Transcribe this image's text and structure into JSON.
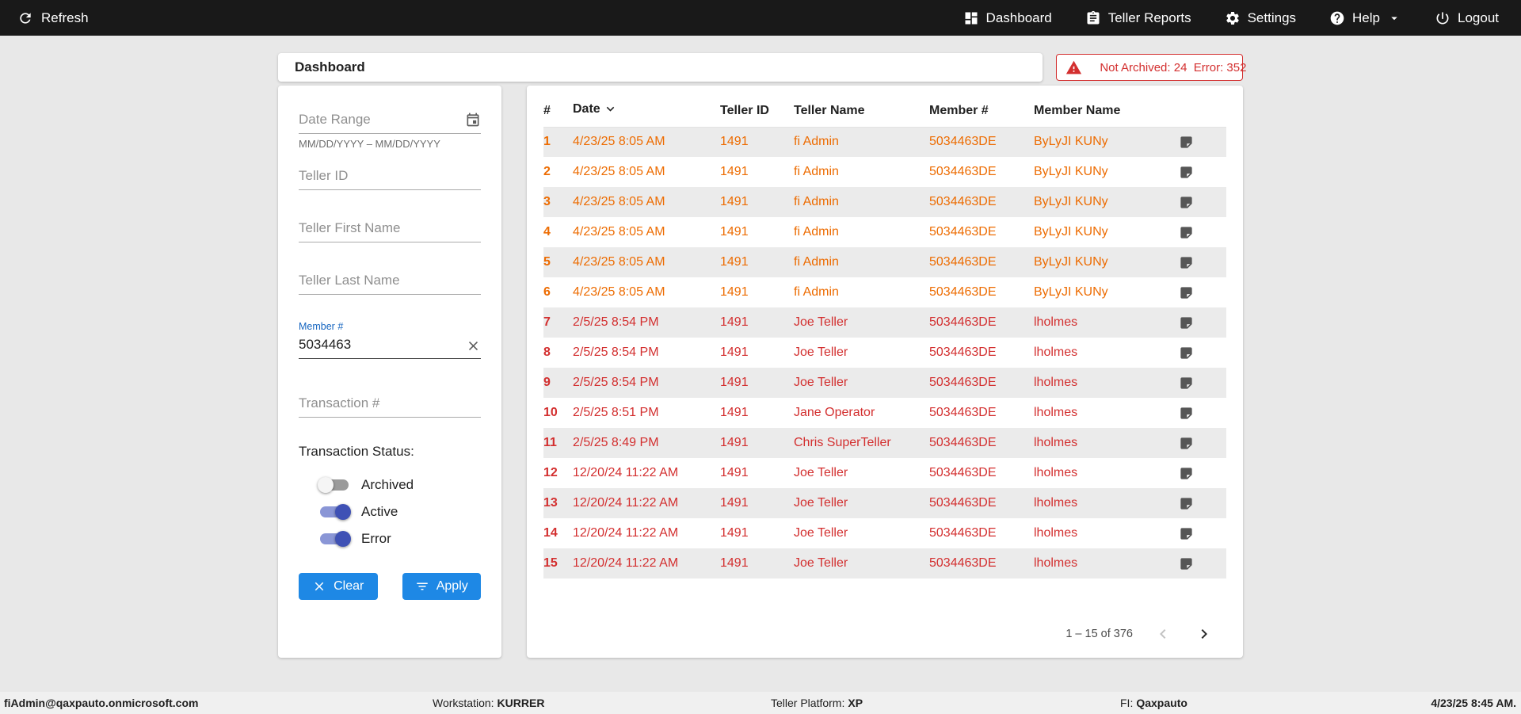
{
  "navbar": {
    "refresh_label": "Refresh",
    "dashboard_label": "Dashboard",
    "teller_reports_label": "Teller Reports",
    "settings_label": "Settings",
    "help_label": "Help",
    "logout_label": "Logout"
  },
  "header": {
    "title": "Dashboard",
    "alert_text": "Not Archived: 24  Error: 352"
  },
  "filters": {
    "date_range_placeholder": "Date Range",
    "date_range_helper": "MM/DD/YYYY – MM/DD/YYYY",
    "teller_id_placeholder": "Teller ID",
    "teller_first_name_placeholder": "Teller First Name",
    "teller_last_name_placeholder": "Teller Last Name",
    "member_label": "Member #",
    "member_value": "5034463",
    "transaction_placeholder": "Transaction #",
    "status_label": "Transaction Status:",
    "toggles": [
      {
        "label": "Archived",
        "on": false
      },
      {
        "label": "Active",
        "on": true
      },
      {
        "label": "Error",
        "on": true
      }
    ],
    "clear_label": "Clear",
    "apply_label": "Apply"
  },
  "table": {
    "columns": [
      "#",
      "Date",
      "Teller ID",
      "Teller Name",
      "Member #",
      "Member Name"
    ],
    "rows": [
      {
        "num": "1",
        "date": "4/23/25 8:05 AM",
        "teller_id": "1491",
        "teller_name": "fi Admin",
        "member": "5034463DE",
        "member_name": "ByLyJI KUNy",
        "status": "warning"
      },
      {
        "num": "2",
        "date": "4/23/25 8:05 AM",
        "teller_id": "1491",
        "teller_name": "fi Admin",
        "member": "5034463DE",
        "member_name": "ByLyJI KUNy",
        "status": "warning"
      },
      {
        "num": "3",
        "date": "4/23/25 8:05 AM",
        "teller_id": "1491",
        "teller_name": "fi Admin",
        "member": "5034463DE",
        "member_name": "ByLyJI KUNy",
        "status": "warning"
      },
      {
        "num": "4",
        "date": "4/23/25 8:05 AM",
        "teller_id": "1491",
        "teller_name": "fi Admin",
        "member": "5034463DE",
        "member_name": "ByLyJI KUNy",
        "status": "warning"
      },
      {
        "num": "5",
        "date": "4/23/25 8:05 AM",
        "teller_id": "1491",
        "teller_name": "fi Admin",
        "member": "5034463DE",
        "member_name": "ByLyJI KUNy",
        "status": "warning"
      },
      {
        "num": "6",
        "date": "4/23/25 8:05 AM",
        "teller_id": "1491",
        "teller_name": "fi Admin",
        "member": "5034463DE",
        "member_name": "ByLyJI KUNy",
        "status": "warning"
      },
      {
        "num": "7",
        "date": "2/5/25 8:54 PM",
        "teller_id": "1491",
        "teller_name": "Joe Teller",
        "member": "5034463DE",
        "member_name": "lholmes",
        "status": "error"
      },
      {
        "num": "8",
        "date": "2/5/25 8:54 PM",
        "teller_id": "1491",
        "teller_name": "Joe Teller",
        "member": "5034463DE",
        "member_name": "lholmes",
        "status": "error"
      },
      {
        "num": "9",
        "date": "2/5/25 8:54 PM",
        "teller_id": "1491",
        "teller_name": "Joe Teller",
        "member": "5034463DE",
        "member_name": "lholmes",
        "status": "error"
      },
      {
        "num": "10",
        "date": "2/5/25 8:51 PM",
        "teller_id": "1491",
        "teller_name": "Jane Operator",
        "member": "5034463DE",
        "member_name": "lholmes",
        "status": "error"
      },
      {
        "num": "11",
        "date": "2/5/25 8:49 PM",
        "teller_id": "1491",
        "teller_name": "Chris SuperTeller",
        "member": "5034463DE",
        "member_name": "lholmes",
        "status": "error"
      },
      {
        "num": "12",
        "date": "12/20/24 11:22 AM",
        "teller_id": "1491",
        "teller_name": "Joe Teller",
        "member": "5034463DE",
        "member_name": "lholmes",
        "status": "error"
      },
      {
        "num": "13",
        "date": "12/20/24 11:22 AM",
        "teller_id": "1491",
        "teller_name": "Joe Teller",
        "member": "5034463DE",
        "member_name": "lholmes",
        "status": "error"
      },
      {
        "num": "14",
        "date": "12/20/24 11:22 AM",
        "teller_id": "1491",
        "teller_name": "Joe Teller",
        "member": "5034463DE",
        "member_name": "lholmes",
        "status": "error"
      },
      {
        "num": "15",
        "date": "12/20/24 11:22 AM",
        "teller_id": "1491",
        "teller_name": "Joe Teller",
        "member": "5034463DE",
        "member_name": "lholmes",
        "status": "error"
      }
    ],
    "pagination_label": "1 – 15 of 376"
  },
  "footer": {
    "user": "fiAdmin@qaxpauto.onmicrosoft.com",
    "workstation_label": "Workstation:",
    "workstation_value": "KURRER",
    "platform_label": "Teller Platform:",
    "platform_value": "XP",
    "fi_label": "FI:",
    "fi_value": "Qaxpauto",
    "datetime": "4/23/25 8:45 AM."
  },
  "colors": {
    "warning_row": "#ed6c02",
    "error_row": "#d32f2f",
    "button_blue": "#1e88e5",
    "toggle_on": "#3f51b5",
    "alert_red": "#d32f2f",
    "navbar_bg": "#191919"
  }
}
